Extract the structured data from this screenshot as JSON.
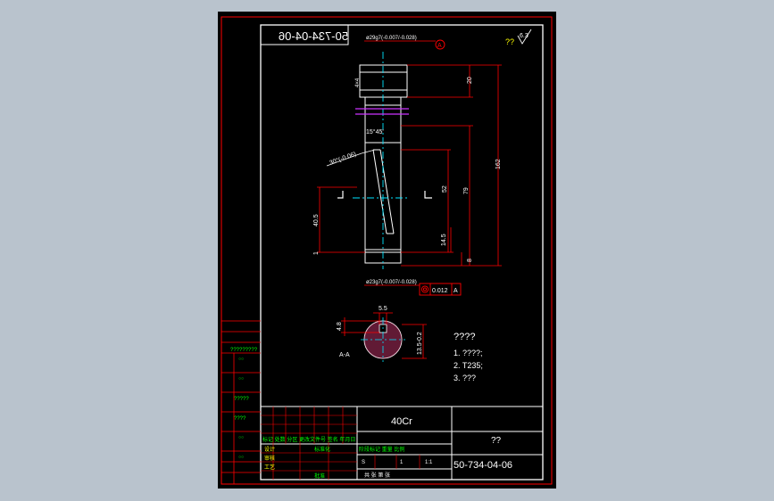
{
  "drawing": {
    "code_top": "50-734-04-06",
    "code_bottom": "50-734-04-06",
    "material": "40Cr",
    "part_name": "??",
    "roughness_label": "??",
    "roughness_value": "6.3",
    "datum_label": "A",
    "dim_top_fit": "ø29g7(-0.007/-0.028)",
    "dim_bottom_fit": "ø23g7(-0.007/-0.028)",
    "dim_20": "20",
    "dim_162": "162",
    "dim_79": "79",
    "dim_52": "52",
    "dim_14_5": "14.5",
    "dim_8": "8",
    "dim_40_5": "40.5",
    "dim_1": "1",
    "dim_15_45": "15°45'",
    "dim_30": "30°(-0.06)",
    "dim_5_5": "5.5",
    "dim_4_8": "4.8",
    "dim_13_5": "13.5-0.2",
    "tolerance_value": "0.012",
    "tolerance_datum": "A",
    "section_label": "A-A"
  },
  "notes": {
    "title": "????",
    "items": [
      "1. ????;",
      "2. T235;",
      "3. ???"
    ]
  },
  "title_block": {
    "header_row": "标记 处数 分区 更改文件号 签名 年月日",
    "row_design": "设计",
    "row_standard": "标准化",
    "row_review": "审核",
    "row_process": "工艺",
    "row_approve": "批准",
    "row_stage": "阶段标记 重量 比例",
    "stage_s": "S",
    "weight_1": "1",
    "scale": "1:1",
    "sheets": "共  张  第  张"
  },
  "side_table": {
    "label_1": "?????????",
    "label_2": "?????",
    "label_3": "????"
  }
}
